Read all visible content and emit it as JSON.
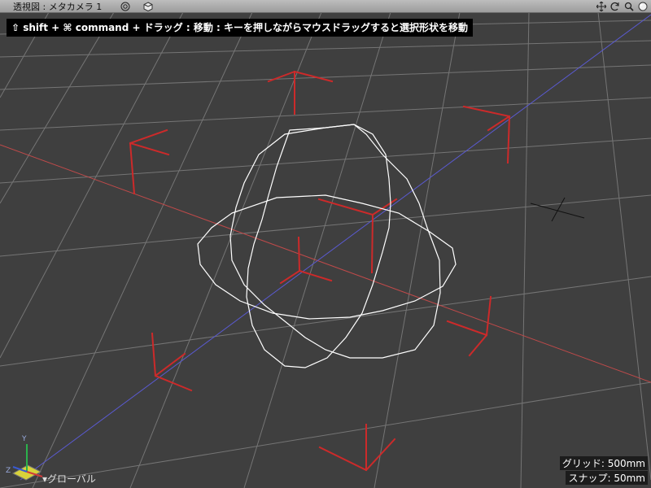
{
  "viewport": {
    "title": "透視図 : メタカメラ 1",
    "hint": "⇧ shift + ⌘ command + ドラッグ : 移動 : キーを押しながらマウスドラッグすると選択形状を移動"
  },
  "toolbar": {
    "left_icons": [
      "target-icon",
      "cube-icon"
    ],
    "right_icons": [
      "move-icon",
      "rotate-icon",
      "zoom-icon",
      "sphere-icon"
    ]
  },
  "status": {
    "grid": "グリッド: 500mm",
    "snap": "スナップ: 50mm"
  },
  "coordinate": {
    "label": "グローバル",
    "axis_y": "Y",
    "axis_z": "Z"
  },
  "colors": {
    "grid": "#767676",
    "x_axis": "#c04a4a",
    "z_axis": "#5a5ad0",
    "selection": "#d0202a",
    "wire": "#ffffff"
  }
}
